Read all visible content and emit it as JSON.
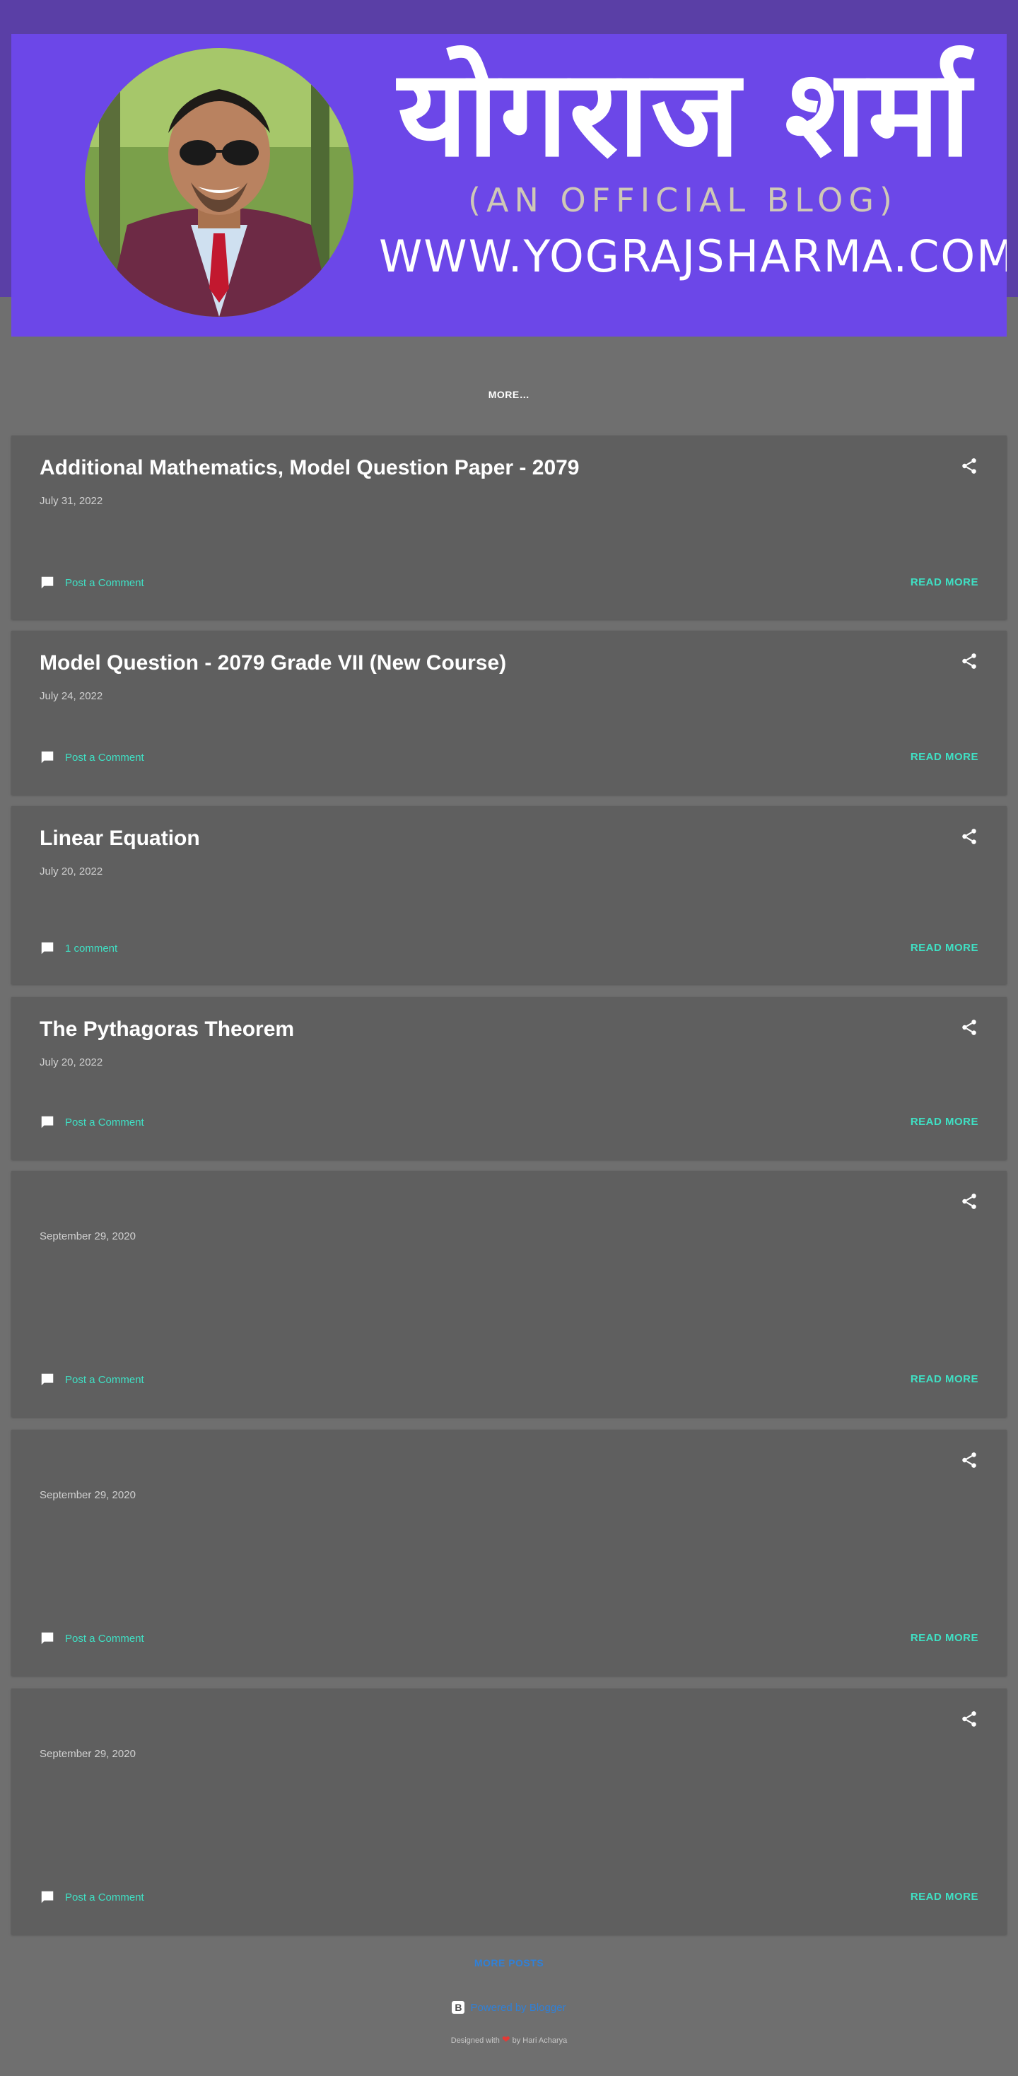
{
  "header": {
    "banner_title": "योगराज शर्मा",
    "banner_subtitle": "(AN OFFICIAL BLOG)",
    "banner_url": "WWW.YOGRAJSHARMA.COM.NP",
    "tagline": "",
    "more_nav": "MORE…"
  },
  "posts": [
    {
      "title": "Additional Mathematics, Model Question Paper - 2079",
      "date": "July 31, 2022",
      "snippet": "",
      "comments": "Post a Comment",
      "read_more": "READ MORE"
    },
    {
      "title": "Model Question - 2079 Grade VII (New Course)",
      "date": "July 24, 2022",
      "snippet": "",
      "comments": "Post a Comment",
      "read_more": "READ MORE"
    },
    {
      "title": "Linear Equation",
      "date": "July 20, 2022",
      "snippet": "",
      "comments": "1 comment",
      "read_more": "READ MORE"
    },
    {
      "title": "The Pythagoras Theorem",
      "date": "July 20, 2022",
      "snippet": "",
      "comments": "Post a Comment",
      "read_more": "READ MORE"
    },
    {
      "title": "",
      "date": "September 29, 2020",
      "snippet": "",
      "comments": "Post a Comment",
      "read_more": "READ MORE"
    },
    {
      "title": "",
      "date": "September 29, 2020",
      "snippet": "",
      "comments": "Post a Comment",
      "read_more": "READ MORE"
    },
    {
      "title": "",
      "date": "September 29, 2020",
      "snippet": "",
      "comments": "Post a Comment",
      "read_more": "READ MORE"
    }
  ],
  "footer": {
    "more_posts": "MORE POSTS",
    "powered_by": "Powered by Blogger",
    "credit_prefix": "Designed with",
    "credit_suffix": "by Hari Acharya"
  },
  "colors": {
    "banner_bg": "#6c47e8",
    "page_bg": "#6f6f6f",
    "card_bg": "#5f5f5f",
    "accent": "#3fe0c4",
    "link_blue": "#2f80d8"
  },
  "icons": {
    "share": "share-icon",
    "comment": "comment-icon",
    "blogger": "blogger-icon",
    "heart": "heart-icon"
  }
}
